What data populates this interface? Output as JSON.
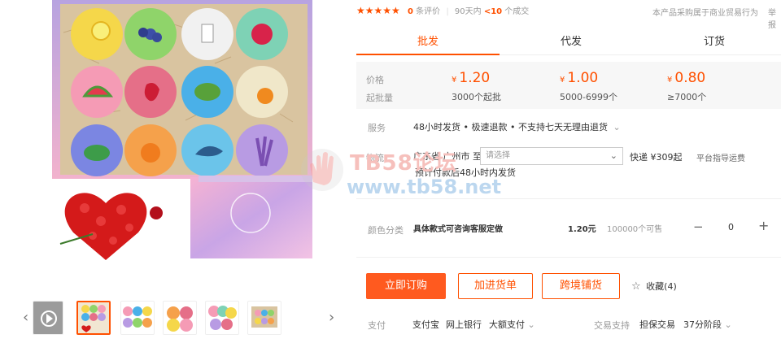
{
  "product": {
    "rating_stars": "★★★★★",
    "review_count": "0",
    "review_label": "条评价",
    "sales_prefix": "90天内",
    "sales_count": "<10",
    "sales_suffix": "个成交",
    "notice": "本产品采购属于商业贸易行为",
    "notice_cut": "举报"
  },
  "tabs": [
    "批发",
    "代发",
    "订货"
  ],
  "price_box": {
    "price_label": "价格",
    "qty_label": "起批量",
    "currency": "¥",
    "tiers": [
      {
        "price": "1.20",
        "qty": "3000个起批"
      },
      {
        "price": "1.00",
        "qty": "5000-6999个"
      },
      {
        "price": "0.80",
        "qty": "≥7000个"
      }
    ]
  },
  "service": {
    "label": "服务",
    "text": "48小时发货 • 极速退款 • 不支持七天无理由退货",
    "chevron": "⌄"
  },
  "shipping": {
    "label": "物流",
    "from": "广东省 广州市 至",
    "select_placeholder": "请选择",
    "freight": "快递 ¥309起",
    "freight_guide": "平台指导运费",
    "delivery": "预计付款后48小时内发货"
  },
  "variant": {
    "label": "颜色分类",
    "name": "具体款式可咨询客服定做",
    "price": "1.20元",
    "stock": "100000个可售",
    "minus": "−",
    "quantity": "0",
    "plus": "+"
  },
  "actions": {
    "buy_now": "立即订购",
    "add_to_list": "加进货单",
    "cross_border": "跨境铺货",
    "favorite": "收藏(4)"
  },
  "payment": {
    "label": "支付",
    "methods": [
      "支付宝",
      "网上银行",
      "大额支付"
    ],
    "trade_label": "交易支持",
    "trade_items": [
      "担保交易",
      "37分阶段"
    ]
  },
  "watermark": {
    "title": "TB58论坛",
    "url": "www.tb58.net"
  },
  "thumbnails": {
    "prev": "‹",
    "next": "›",
    "count": "6"
  },
  "colors": {
    "accent": "#ff5000"
  }
}
